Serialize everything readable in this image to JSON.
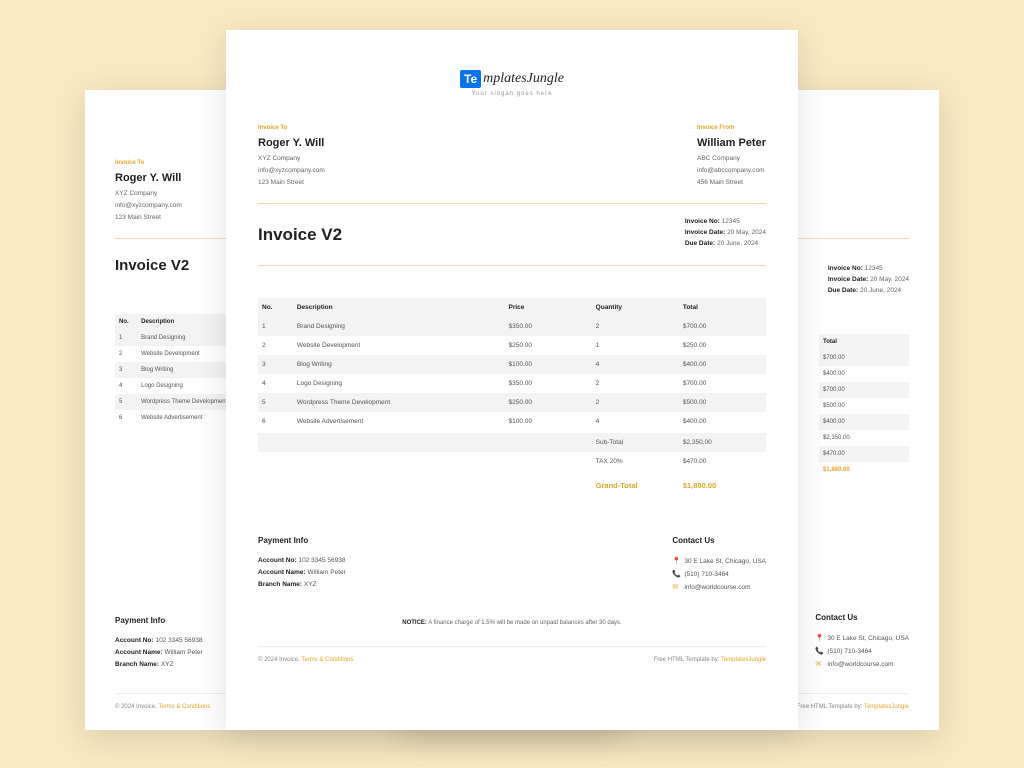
{
  "logo": {
    "prefix": "Te",
    "rest": "mplatesJungle",
    "tagline": "Your slogan goes here"
  },
  "invoice_to": {
    "label": "Invoice To",
    "name": "Roger Y. Will",
    "company": "XYZ Company",
    "email": "info@xyzcompany.com",
    "address": "123 Main Street"
  },
  "invoice_from": {
    "label": "Invoice From",
    "name": "William Peter",
    "company": "ABC Company",
    "email": "info@abccompany.com",
    "address": "456 Main Street"
  },
  "title": "Invoice V2",
  "meta": {
    "no_label": "Invoice No:",
    "no_value": "12345",
    "date_label": "Invoice Date:",
    "date_value": "20 May, 2024",
    "due_label": "Due Date:",
    "due_value": "20 June, 2024"
  },
  "columns": {
    "no": "No.",
    "desc": "Description",
    "price": "Price",
    "qty": "Quantity",
    "total": "Total"
  },
  "items": [
    {
      "no": "1",
      "desc": "Brand Designing",
      "price": "$350.00",
      "qty": "2",
      "total": "$700.00"
    },
    {
      "no": "2",
      "desc": "Website Development",
      "price": "$250.00",
      "qty": "1",
      "total": "$250.00"
    },
    {
      "no": "3",
      "desc": "Blog Writing",
      "price": "$100.00",
      "qty": "4",
      "total": "$400.00"
    },
    {
      "no": "4",
      "desc": "Logo Designing",
      "price": "$350.00",
      "qty": "2",
      "total": "$700.00"
    },
    {
      "no": "5",
      "desc": "Wordpress Theme Development",
      "price": "$250.00",
      "qty": "2",
      "total": "$500.00"
    },
    {
      "no": "6",
      "desc": "Website Advertisement",
      "price": "$100.00",
      "qty": "4",
      "total": "$400.00"
    }
  ],
  "summary": {
    "subtotal_label": "Sub-Total",
    "subtotal_value": "$2,350.00",
    "tax_label": "TAX 20%",
    "tax_value": "$470.00",
    "grand_label": "Grand-Total",
    "grand_value": "$1,880.00"
  },
  "payment": {
    "title": "Payment Info",
    "account_no_label": "Account No:",
    "account_no_value": "102 3345 56938",
    "account_name_label": "Account Name:",
    "account_name_value": "William Peter",
    "branch_label": "Branch Name:",
    "branch_value": "XYZ"
  },
  "contact": {
    "title": "Contact Us",
    "address": "30 E Lake St, Chicago, USA",
    "phone": "(510) 710-3464",
    "email": "info@worldcourse.com"
  },
  "notice": {
    "label": "NOTICE:",
    "text": "A finance charge of 1.5% will be made on unpaid balances after 30 days."
  },
  "footer": {
    "left_prefix": "© 2024 Invoice.",
    "left_link": "Terms & Conditions",
    "right_prefix": "Free HTML Template by:",
    "right_link": "TemplatesJungle"
  }
}
